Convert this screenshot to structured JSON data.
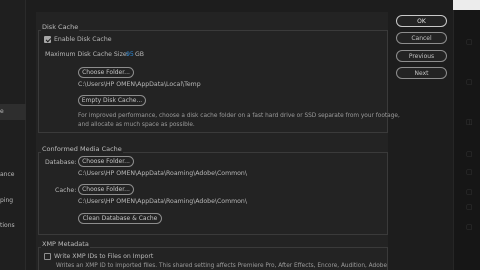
{
  "sidebar": {
    "items": [
      {
        "label": "e"
      },
      {
        "label": "ance"
      },
      {
        "label": "ping"
      },
      {
        "label": "tions"
      }
    ]
  },
  "disk_cache": {
    "title": "Disk Cache",
    "enable_label": "Enable Disk Cache",
    "enabled": true,
    "max_size_label": "Maximum Disk Cache Size:",
    "max_size_value": "95",
    "max_size_unit": "GB",
    "choose_folder_label": "Choose Folder...",
    "path": "C:\\Users\\HP OMEN\\AppData\\Local\\Temp",
    "empty_label": "Empty Disk Cache...",
    "hint_line1": "For improved performance, choose a disk cache folder on a fast hard drive or SSD separate from your footage,",
    "hint_line2": "and allocate as much space as possible."
  },
  "conformed": {
    "title": "Conformed Media Cache",
    "database_label": "Database:",
    "database_button": "Choose Folder...",
    "database_path": "C:\\Users\\HP OMEN\\AppData\\Roaming\\Adobe\\Common\\",
    "cache_label": "Cache:",
    "cache_button": "Choose Folder...",
    "cache_path": "C:\\Users\\HP OMEN\\AppData\\Roaming\\Adobe\\Common\\",
    "clean_label": "Clean Database & Cache"
  },
  "xmp": {
    "title": "XMP Metadata",
    "write_label": "Write XMP IDs to Files on Import",
    "write_checked": false,
    "hint": "Writes an XMP ID to imported files. This shared setting affects Premiere Pro, After Effects, Encore, Audition, Adobe"
  },
  "dialog_buttons": {
    "ok": "OK",
    "cancel": "Cancel",
    "previous": "Previous",
    "next": "Next"
  }
}
